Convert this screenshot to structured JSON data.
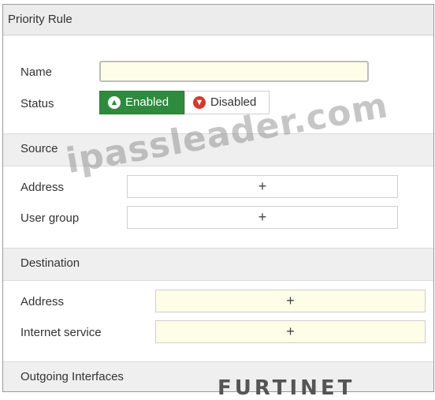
{
  "dialog": {
    "title": "Priority Rule"
  },
  "general": {
    "name_label": "Name",
    "name_value": "",
    "status_label": "Status",
    "status_enabled_label": "Enabled",
    "status_disabled_label": "Disabled",
    "status_selected": "Enabled",
    "enabled_icon": "arrow-up-circle-icon",
    "disabled_icon": "arrow-down-circle-icon"
  },
  "source": {
    "section_label": "Source",
    "address_label": "Address",
    "user_group_label": "User group",
    "add_symbol": "+"
  },
  "destination": {
    "section_label": "Destination",
    "address_label": "Address",
    "internet_service_label": "Internet service",
    "add_symbol": "+"
  },
  "outgoing": {
    "section_label": "Outgoing Interfaces"
  },
  "overlay": {
    "watermark": "ipassleader.com",
    "logo": "FURTINET"
  },
  "colors": {
    "enabled_green": "#2e8b3e",
    "disabled_red": "#d23a2e",
    "input_yellow": "#fdfde8",
    "section_gray": "#efefef"
  }
}
